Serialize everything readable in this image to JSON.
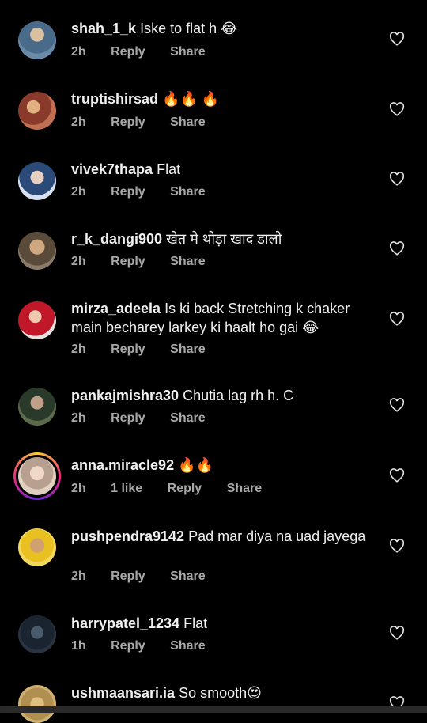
{
  "comments": [
    {
      "username": "shah_1_k",
      "text": "Iske to flat h 😂",
      "time": "2h",
      "likes": "",
      "reply": "Reply",
      "share": "Share",
      "avatar_colors": [
        "#5a7a9a",
        "#c8b89a"
      ]
    },
    {
      "username": "truptishirsad",
      "text": "🔥🔥 🔥",
      "time": "2h",
      "likes": "",
      "reply": "Reply",
      "share": "Share",
      "avatar_colors": [
        "#8a4a3a",
        "#d8a070"
      ]
    },
    {
      "username": "vivek7thapa",
      "text": "Flat",
      "time": "2h",
      "likes": "",
      "reply": "Reply",
      "share": "Share",
      "avatar_colors": [
        "#3a5a8a",
        "#e0e8f0"
      ]
    },
    {
      "username": "r_k_dangi900",
      "text": "खेत मे थोड़ा खाद डालो",
      "time": "2h",
      "likes": "",
      "reply": "Reply",
      "share": "Share",
      "avatar_colors": [
        "#6a5a4a",
        "#c0a080"
      ]
    },
    {
      "username": "mirza_adeela",
      "text": "Is ki back Stretching k chaker main becharey larkey ki haalt ho gai 😂",
      "time": "2h",
      "likes": "",
      "reply": "Reply",
      "share": "Share",
      "avatar_colors": [
        "#c02030",
        "#f0c0b0"
      ]
    },
    {
      "username": "pankajmishra30",
      "text": "Chutia lag rh h. C",
      "time": "2h",
      "likes": "",
      "reply": "Reply",
      "share": "Share",
      "avatar_colors": [
        "#3a4a3a",
        "#8a9a7a"
      ]
    },
    {
      "username": "anna.miracle92",
      "text": "🔥🔥",
      "time": "2h",
      "likes": "1 like",
      "reply": "Reply",
      "share": "Share",
      "avatar_colors": [
        "#c0b0a0",
        "#e8d8c8"
      ]
    },
    {
      "username": "pushpendra9142",
      "text": "Pad mar diya na uad jayega",
      "time": "2h",
      "likes": "",
      "reply": "Reply",
      "share": "Share",
      "avatar_colors": [
        "#e8c020",
        "#d0a070"
      ]
    },
    {
      "username": "harrypatel_1234",
      "text": "Flat",
      "time": "1h",
      "likes": "",
      "reply": "Reply",
      "share": "Share",
      "avatar_colors": [
        "#1a2a3a",
        "#3a4a5a"
      ]
    },
    {
      "username": "ushmaansari.ia",
      "text": "So smooth😍",
      "time": "",
      "likes": "",
      "reply": "",
      "share": "",
      "avatar_colors": [
        "#c0a060",
        "#e0c080"
      ]
    }
  ],
  "icons": {
    "like": "heart-outline-icon"
  },
  "colors": {
    "background": "#000000",
    "meta": "#a8a8a8",
    "text": "#f0f0f0"
  }
}
